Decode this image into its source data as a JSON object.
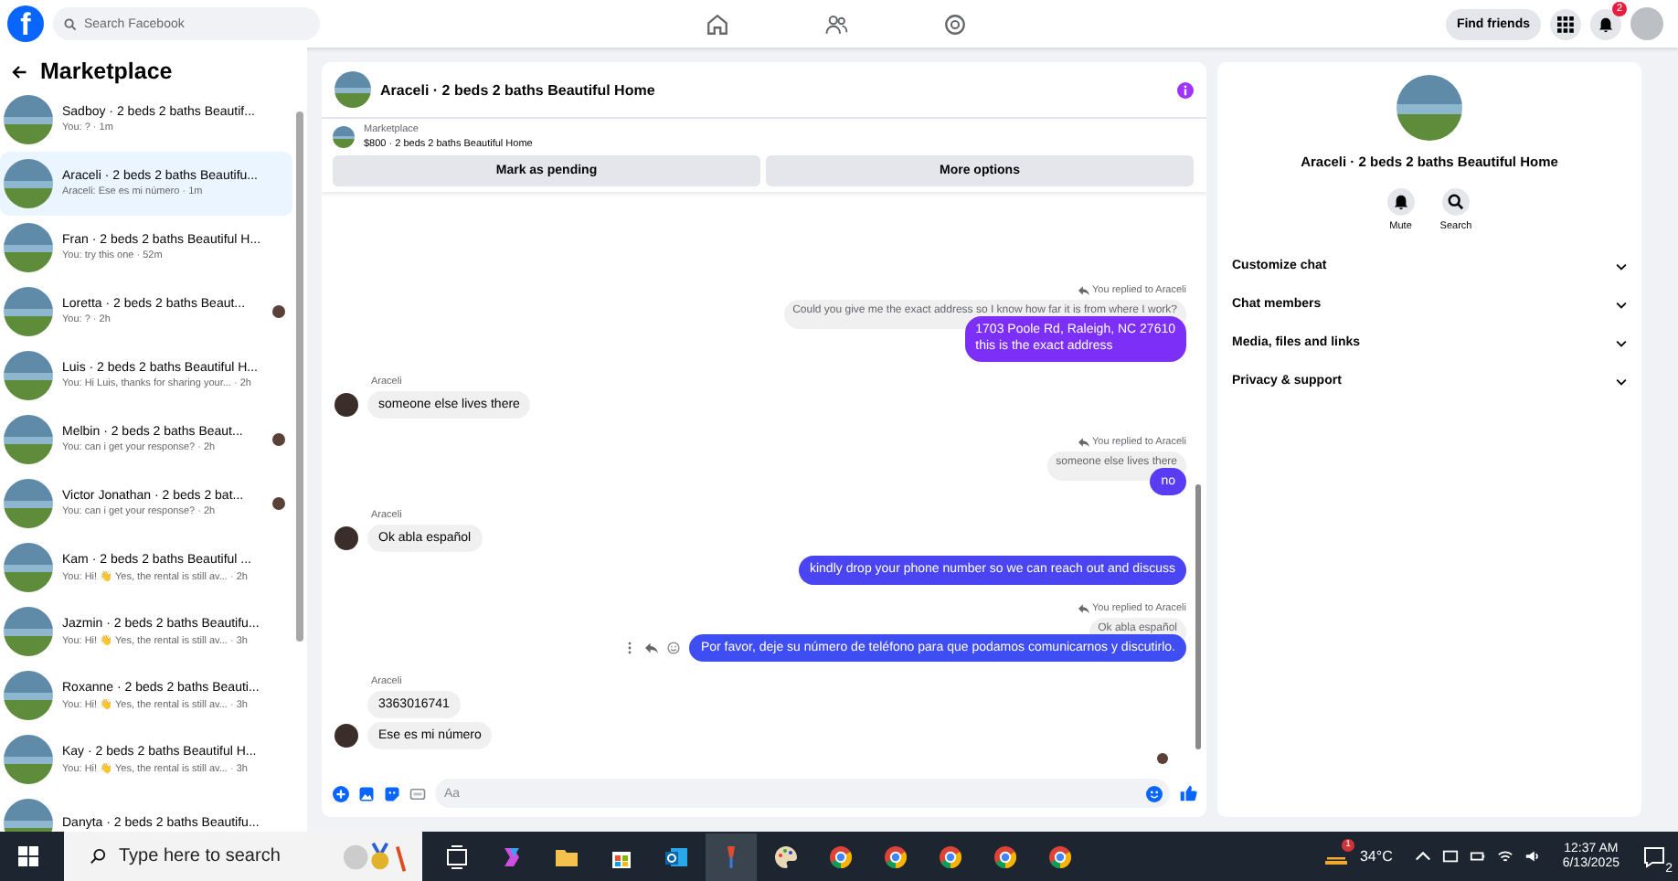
{
  "nav": {
    "logo": "f",
    "search": {
      "placeholder": "Search Facebook"
    },
    "find_friends": "Find friends",
    "notifications_badge": "2"
  },
  "sidebar": {
    "title": "Marketplace",
    "items": [
      {
        "name": "Sadboy · 2 beds 2 baths Beautif...",
        "preview": "You: ? · 1m",
        "selected": false,
        "seen_avatar": false
      },
      {
        "name": "Araceli · 2 beds 2 baths Beautifu...",
        "preview": "Araceli: Ese es mi número · 1m",
        "selected": true,
        "seen_avatar": false
      },
      {
        "name": "Fran · 2 beds 2 baths Beautiful H...",
        "preview": "You: try this one · 52m",
        "selected": false,
        "seen_avatar": false
      },
      {
        "name": "Loretta · 2 beds 2 baths Beaut...",
        "preview": "You: ? · 2h",
        "selected": false,
        "seen_avatar": true
      },
      {
        "name": "Luis · 2 beds 2 baths Beautiful H...",
        "preview": "You: Hi Luis, thanks for sharing your... · 2h",
        "selected": false,
        "seen_avatar": false
      },
      {
        "name": "Melbin · 2 beds 2 baths Beaut...",
        "preview": "You: can i get your response? · 2h",
        "selected": false,
        "seen_avatar": true
      },
      {
        "name": "Victor Jonathan · 2 beds 2 bat...",
        "preview": "You: can i get your response? · 2h",
        "selected": false,
        "seen_avatar": true
      },
      {
        "name": "Kam · 2 beds 2 baths Beautiful ...",
        "preview": "You: Hi! 👋 Yes, the rental is still av... · 2h",
        "selected": false,
        "seen_avatar": false
      },
      {
        "name": "Jazmin · 2 beds 2 baths Beautifu...",
        "preview": "You: Hi! 👋 Yes, the rental is still av... · 3h",
        "selected": false,
        "seen_avatar": false
      },
      {
        "name": "Roxanne · 2 beds 2 baths Beauti...",
        "preview": "You: Hi! 👋 Yes, the rental is still av... · 3h",
        "selected": false,
        "seen_avatar": false
      },
      {
        "name": "Kay · 2 beds 2 baths Beautiful H...",
        "preview": "You: Hi! 👋 Yes, the rental is still av... · 3h",
        "selected": false,
        "seen_avatar": false
      },
      {
        "name": "Danyta · 2 beds 2 baths Beautifu...",
        "selected": false,
        "seen_avatar": false
      }
    ]
  },
  "chat": {
    "title": "Araceli · 2 beds 2 baths Beautiful Home",
    "listing": {
      "label": "Marketplace",
      "title": "$800 · 2 beds 2 baths Beautiful Home"
    },
    "buttons": [
      "Mark as pending",
      "More options"
    ],
    "messages": [
      {
        "kind": "reply_note",
        "text": "You replied to Araceli"
      },
      {
        "kind": "quoted",
        "text": "Could you give me the exact address so I know how far it is from where I work?"
      },
      {
        "kind": "outgoing",
        "lines": [
          "1703 Poole Rd, Raleigh, NC 27610",
          "this is the exact address"
        ],
        "color": "#7b2ff7",
        "actions": false
      },
      {
        "kind": "sender",
        "text": "Araceli"
      },
      {
        "kind": "incoming",
        "text": "someone else lives there",
        "avatar": true
      },
      {
        "kind": "reply_note",
        "text": "You replied to Araceli"
      },
      {
        "kind": "quoted",
        "text": "someone else lives there"
      },
      {
        "kind": "outgoing",
        "lines": [
          "no"
        ],
        "color": "#5b3cf5",
        "actions": false
      },
      {
        "kind": "sender",
        "text": "Araceli"
      },
      {
        "kind": "incoming",
        "text": "Ok abla español",
        "avatar": true
      },
      {
        "kind": "outgoing",
        "lines": [
          "kindly drop your phone number so we can reach out and discuss"
        ],
        "color": "#4a44f2",
        "actions": false
      },
      {
        "kind": "reply_note",
        "text": "You replied to Araceli"
      },
      {
        "kind": "quoted",
        "text": "Ok abla español"
      },
      {
        "kind": "outgoing",
        "lines": [
          "Por favor, deje su número de teléfono para que podamos comunicarnos y discutirlo."
        ],
        "color": "#3f4ef3",
        "actions": true
      },
      {
        "kind": "sender",
        "text": "Araceli"
      },
      {
        "kind": "incoming",
        "text": "3363016741",
        "avatar": false
      },
      {
        "kind": "incoming",
        "text": "Ese es mi número",
        "avatar": true
      },
      {
        "kind": "seen"
      }
    ],
    "composer": {
      "placeholder": "Aa"
    }
  },
  "details": {
    "title": "Araceli · 2 beds 2 baths Beautiful Home",
    "actions": [
      "Mute",
      "Search"
    ],
    "sections": [
      {
        "label": "Customize chat",
        "expanded": false
      },
      {
        "label": "Chat members",
        "expanded": false
      },
      {
        "label": "Media, files and links",
        "expanded": false
      },
      {
        "label": "Privacy & support",
        "expanded": false
      }
    ]
  },
  "taskbar": {
    "search_placeholder": "Type here to search",
    "weather_badge": "1",
    "temperature": "34°C",
    "time": "12:37 AM",
    "date": "6/13/2025",
    "notification_count": "2"
  }
}
